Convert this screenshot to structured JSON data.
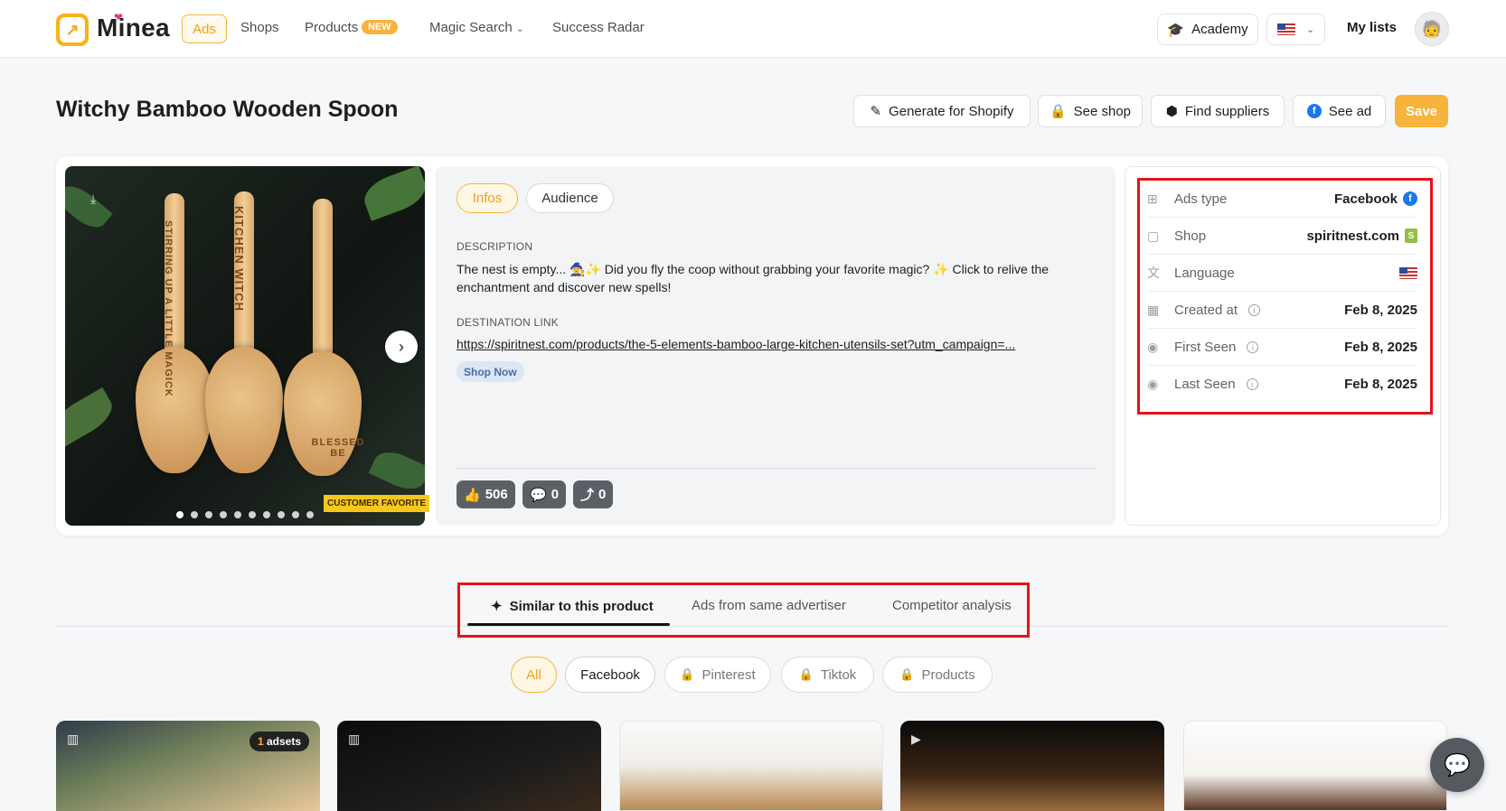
{
  "brand": {
    "name": "Minea"
  },
  "nav": {
    "ads": "Ads",
    "shops": "Shops",
    "products": "Products",
    "new_badge": "NEW",
    "magic_search": "Magic Search",
    "success_radar": "Success Radar",
    "academy": "Academy",
    "my_lists": "My lists"
  },
  "page": {
    "title": "Witchy Bamboo Wooden Spoon"
  },
  "actions": {
    "generate": "Generate for Shopify",
    "see_shop": "See shop",
    "find_suppliers": "Find suppliers",
    "see_ad": "See ad",
    "save": "Save"
  },
  "media": {
    "badge": "CUSTOMER FAVORITE",
    "spoon_texts": [
      "STIRRING UP A LITTLE MAGICK",
      "KITCHEN WITCH",
      "BLESSED BE"
    ],
    "slides": 10,
    "active_slide": 1
  },
  "info": {
    "tabs": [
      "Infos",
      "Audience"
    ],
    "description_label": "DESCRIPTION",
    "description": "The nest is empty... 🧙‍♀️✨ Did you fly the coop without grabbing your favorite magic? ✨ Click to relive the enchantment and discover new spells!",
    "destination_label": "DESTINATION LINK",
    "destination_link": "https://spiritnest.com/products/the-5-elements-bamboo-large-kitchen-utensils-set?utm_campaign=...",
    "cta": "Shop Now",
    "likes": "506",
    "comments": "0",
    "shares": "0"
  },
  "meta": {
    "ads_type_label": "Ads type",
    "ads_type": "Facebook",
    "shop_label": "Shop",
    "shop": "spiritnest.com",
    "language_label": "Language",
    "created_label": "Created at",
    "created": "Feb 8, 2025",
    "first_seen_label": "First Seen",
    "first_seen": "Feb 8, 2025",
    "last_seen_label": "Last Seen",
    "last_seen": "Feb 8, 2025"
  },
  "lower_tabs": {
    "similar": "Similar to this product",
    "same_advertiser": "Ads from same advertiser",
    "competitor": "Competitor analysis"
  },
  "filters": {
    "all": "All",
    "facebook": "Facebook",
    "pinterest": "Pinterest",
    "tiktok": "Tiktok",
    "products": "Products"
  },
  "results": {
    "adsets_count": "1",
    "adsets_label": "adsets"
  },
  "colors": {
    "accent": "#f7b33b",
    "highlight_box": "#e5121c",
    "facebook": "#1877f2"
  }
}
